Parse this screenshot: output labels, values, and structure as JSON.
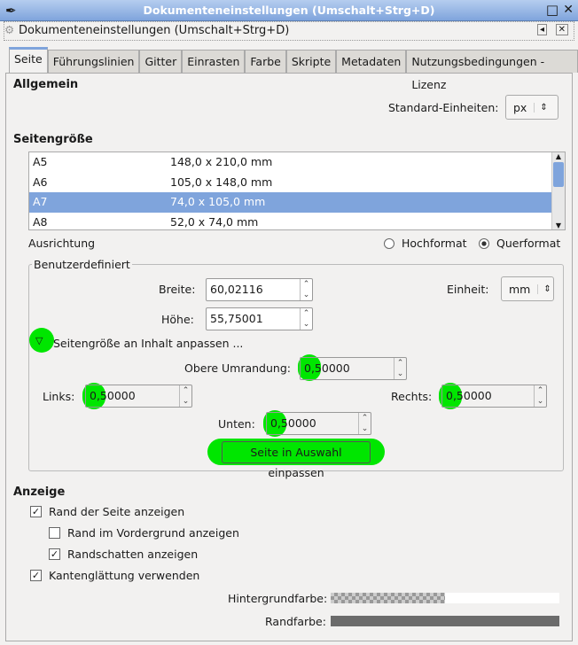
{
  "window": {
    "title": "Dokumenteneinstellungen (Umschalt+Strg+D)",
    "maximize": "□",
    "close": "✕"
  },
  "dock": {
    "title": "Dokumenteneinstellungen (Umschalt+Strg+D)",
    "collapse": "◂",
    "close": "✕"
  },
  "tabs": [
    "Seite",
    "Führungslinien",
    "Gitter",
    "Einrasten",
    "Farbe",
    "Skripte",
    "Metadaten",
    "Nutzungsbedingungen - Lizenz"
  ],
  "general": {
    "heading": "Allgemein",
    "units_label": "Standard-Einheiten:",
    "units_value": "px"
  },
  "page_size": {
    "heading": "Seitengröße",
    "items": [
      {
        "name": "A5",
        "size": "148,0 x 210,0 mm"
      },
      {
        "name": "A6",
        "size": "105,0 x 148,0 mm"
      },
      {
        "name": "A7",
        "size": "74,0 x 105,0 mm",
        "selected": true
      },
      {
        "name": "A8",
        "size": "52,0 x 74,0 mm"
      }
    ],
    "orientation_label": "Ausrichtung",
    "portrait": "Hochformat",
    "landscape": "Querformat",
    "orientation": "landscape"
  },
  "custom": {
    "legend": "Benutzerdefiniert",
    "width_label": "Breite:",
    "width": "60,02116",
    "height_label": "Höhe:",
    "height": "55,75001",
    "unit_label": "Einheit:",
    "unit": "mm",
    "fit_expander": "Seitengröße an Inhalt anpassen ...",
    "top_label": "Obere Umrandung:",
    "top": "0,50000",
    "left_label": "Links:",
    "left": "0,50000",
    "right_label": "Rechts:",
    "right": "0,50000",
    "bottom_label": "Unten:",
    "bottom": "0,50000",
    "fit_button": "Seite in Auswahl einpassen",
    "highlight_color": "#00e600"
  },
  "display": {
    "heading": "Anzeige",
    "show_border": "Rand der Seite anzeigen",
    "border_on_top": "Rand im Vordergrund anzeigen",
    "border_shadow": "Randschatten anzeigen",
    "antialias": "Kantenglättung verwenden",
    "bg_color_label": "Hintergrundfarbe:",
    "border_color_label": "Randfarbe:",
    "border_color": "#6b6b6b"
  }
}
